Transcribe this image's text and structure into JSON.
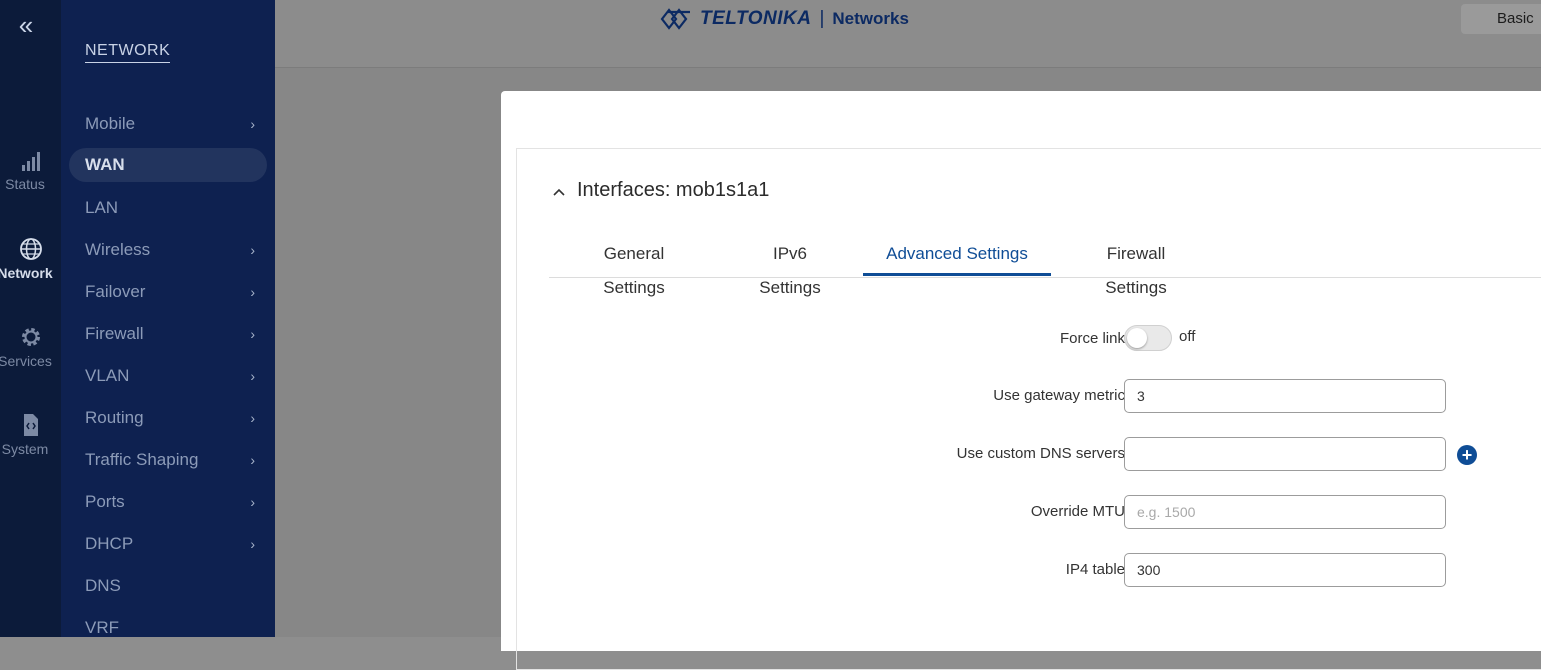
{
  "rail": {
    "collapse_icon": "double-chevron-left-icon",
    "items": [
      {
        "label": "Status",
        "icon": "signal-bars-icon"
      },
      {
        "label": "Network",
        "icon": "globe-icon"
      },
      {
        "label": "Services",
        "icon": "gear-icon"
      },
      {
        "label": "System",
        "icon": "document-code-icon"
      }
    ]
  },
  "nav": {
    "title": "NETWORK",
    "items": [
      {
        "label": "Mobile",
        "chevron": "›"
      },
      {
        "label": "WAN",
        "chevron": ""
      },
      {
        "label": "LAN",
        "chevron": ""
      },
      {
        "label": "Wireless",
        "chevron": "›"
      },
      {
        "label": "Failover",
        "chevron": "›"
      },
      {
        "label": "Firewall",
        "chevron": "›"
      },
      {
        "label": "VLAN",
        "chevron": "›"
      },
      {
        "label": "Routing",
        "chevron": "›"
      },
      {
        "label": "Traffic Shaping",
        "chevron": "›"
      },
      {
        "label": "Ports",
        "chevron": "›"
      },
      {
        "label": "DHCP",
        "chevron": "›"
      },
      {
        "label": "DNS",
        "chevron": ""
      },
      {
        "label": "VRF",
        "chevron": ""
      }
    ]
  },
  "header": {
    "brand": "TELTONIKA",
    "separator": "|",
    "subbrand": "Networks",
    "mode_label": "Basic",
    "brand_color": "#0c2a63"
  },
  "modal": {
    "panel_caret": "^",
    "panel_title": "Interfaces: mob1s1a1",
    "tabs": [
      "General Settings",
      "IPv6 Settings",
      "Advanced Settings",
      "Firewall Settings"
    ],
    "active_tab": "Advanced Settings",
    "fields": {
      "force_link": {
        "label": "Force link",
        "state": "off"
      },
      "gateway_metric": {
        "label": "Use gateway metric",
        "value": "3"
      },
      "custom_dns": {
        "label": "Use custom DNS servers",
        "value": "",
        "add_icon": "plus-circle-icon"
      },
      "override_mtu": {
        "label": "Override MTU",
        "value": "",
        "placeholder": "e.g. 1500"
      },
      "ip4_table": {
        "label": "IP4 table",
        "value": "300"
      }
    }
  },
  "colors": {
    "accent": "#0f4d96",
    "nav_bg": "#0e2150",
    "rail_bg": "#0c1b3a"
  }
}
